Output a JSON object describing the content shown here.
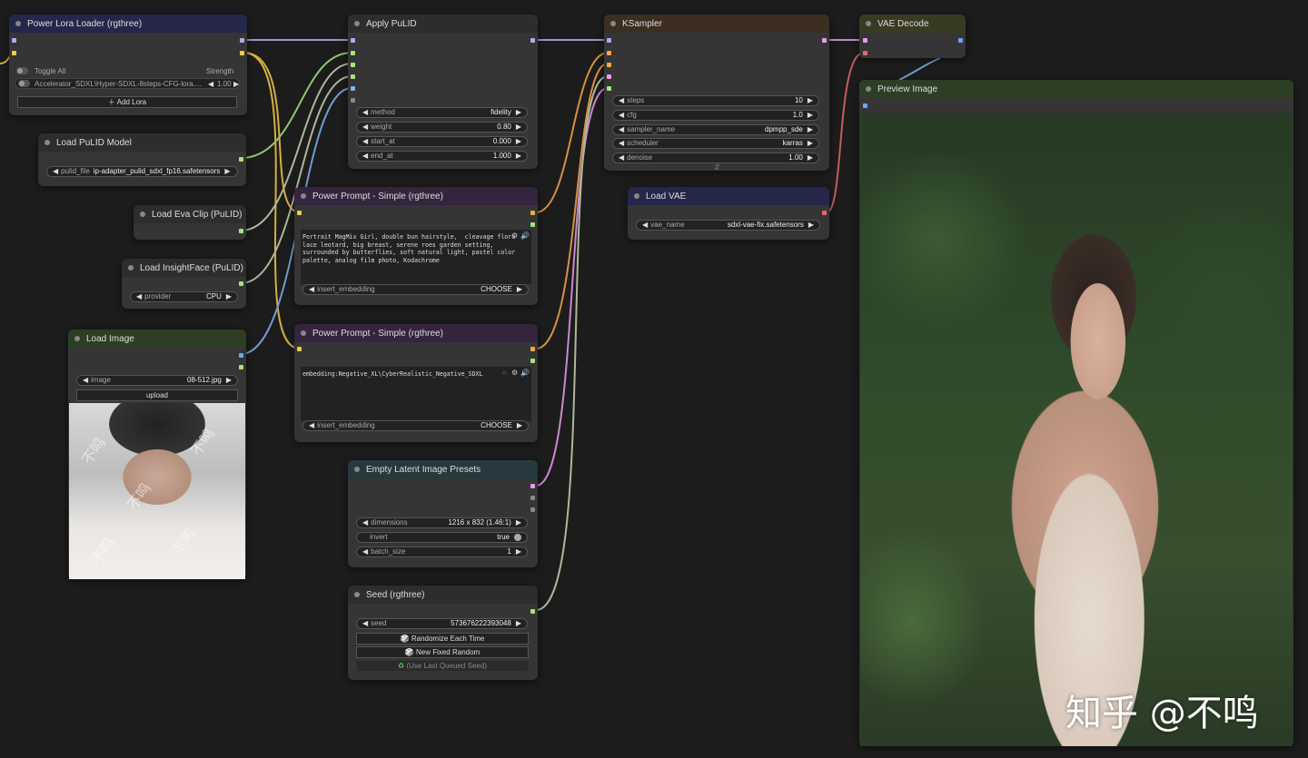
{
  "canvas": {
    "background": "#1c1c1c"
  },
  "power_lora": {
    "title": "Power Lora Loader (rgthree)",
    "toggle_all": "Toggle All",
    "strength_header": "Strength",
    "lora_name": "Accelerator_SDXL\\Hyper-SDXL-8steps-CFG-lora....",
    "lora_strength": "1.00",
    "add_lora": "Add Lora"
  },
  "load_pulid_model": {
    "title": "Load PuLID Model",
    "pulid_file_label": "pulid_file",
    "pulid_file_value": "ip-adapter_pulid_sdxl_fp16.safetensors"
  },
  "load_eva_clip": {
    "title": "Load Eva Clip (PuLID)"
  },
  "load_insightface": {
    "title": "Load InsightFace (PuLID)",
    "provider_label": "provider",
    "provider_value": "CPU"
  },
  "load_image": {
    "title": "Load Image",
    "image_label": "image",
    "image_value": "08-512.jpg",
    "upload_label": "upload"
  },
  "apply_pulid": {
    "title": "Apply PuLID",
    "widgets": [
      {
        "label": "method",
        "value": "fidelity"
      },
      {
        "label": "weight",
        "value": "0.80"
      },
      {
        "label": "start_at",
        "value": "0.000"
      },
      {
        "label": "end_at",
        "value": "1.000"
      }
    ]
  },
  "power_prompt_1": {
    "title": "Power Prompt - Simple (rgthree)",
    "text": "Portrait MagMix Girl, double bun hairstyle,  cleavage flora lace leotard, big breast, serene roes garden setting, surrounded by butterflies, soft natural light, pastel color palette, analog film photo, Kodachrome",
    "embed_label": "insert_embedding",
    "embed_value": "CHOOSE"
  },
  "power_prompt_2": {
    "title": "Power Prompt - Simple (rgthree)",
    "text": "embedding:Negative_XL\\CyberRealistic_Negative_SDXL",
    "embed_label": "insert_embedding",
    "embed_value": "CHOOSE"
  },
  "empty_latent": {
    "title": "Empty Latent Image Presets",
    "dimensions_label": "dimensions",
    "dimensions_value": "1216 x 832  (1.46:1)",
    "invert_label": "invert",
    "invert_value": "true",
    "batch_label": "batch_size",
    "batch_value": "1"
  },
  "seed": {
    "title": "Seed (rgthree)",
    "seed_label": "seed",
    "seed_value": "573676222393048",
    "randomize": "Randomize Each Time",
    "new_fixed": "New Fixed Random",
    "use_last": "(Use Last Queued Seed)"
  },
  "ksampler": {
    "title": "KSampler",
    "widgets": [
      {
        "label": "steps",
        "value": "10"
      },
      {
        "label": "cfg",
        "value": "1.0"
      },
      {
        "label": "sampler_name",
        "value": "dpmpp_sde"
      },
      {
        "label": "scheduler",
        "value": "karras"
      },
      {
        "label": "denoise",
        "value": "1.00"
      }
    ]
  },
  "load_vae": {
    "title": "Load VAE",
    "vae_label": "vae_name",
    "vae_value": "sdxl-vae-fix.safetensors"
  },
  "vae_decode": {
    "title": "VAE Decode"
  },
  "preview_image": {
    "title": "Preview Image",
    "watermark": "知乎 @不鸣"
  },
  "ref_watermark": "不鸣"
}
